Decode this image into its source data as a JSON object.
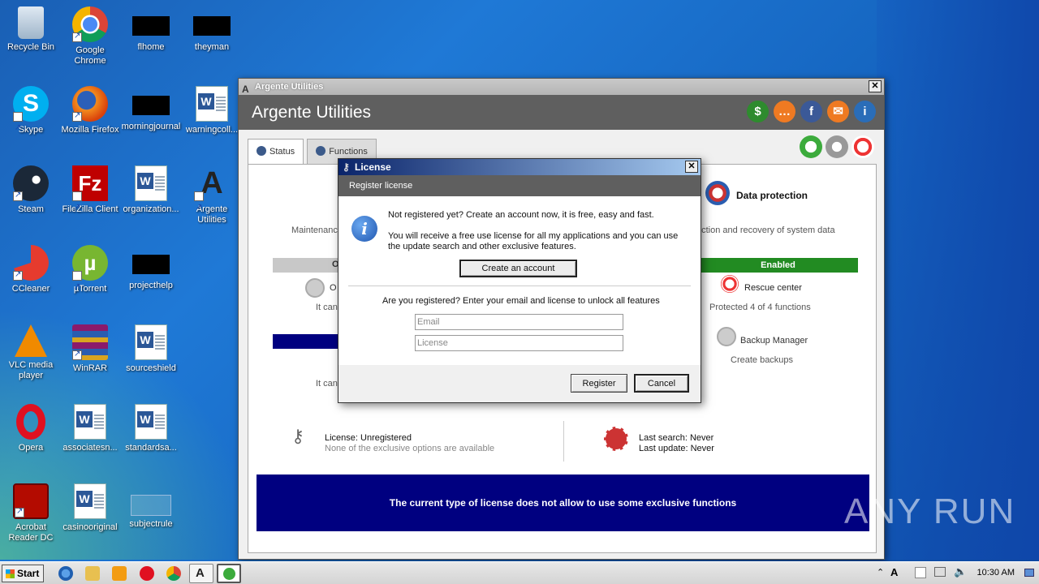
{
  "desktop": {
    "icons": [
      {
        "label": "Recycle Bin"
      },
      {
        "label": "Google Chrome"
      },
      {
        "label": "flhome"
      },
      {
        "label": "theyman"
      },
      {
        "label": "Skype"
      },
      {
        "label": "Mozilla Firefox"
      },
      {
        "label": "morningjournal"
      },
      {
        "label": "warningcoll..."
      },
      {
        "label": "Steam"
      },
      {
        "label": "FileZilla Client"
      },
      {
        "label": "organization..."
      },
      {
        "label": "Argente Utilities"
      },
      {
        "label": "CCleaner"
      },
      {
        "label": "µTorrent"
      },
      {
        "label": "projecthelp"
      },
      {
        "label": "VLC media player"
      },
      {
        "label": "WinRAR"
      },
      {
        "label": "sourceshield"
      },
      {
        "label": "Opera"
      },
      {
        "label": "associatesn..."
      },
      {
        "label": "standardsa..."
      },
      {
        "label": "Acrobat Reader DC"
      },
      {
        "label": "casinooriginal"
      },
      {
        "label": "subjectrule"
      }
    ]
  },
  "window": {
    "title": "Argente Utilities",
    "header": "Argente Utilities",
    "tabs": [
      {
        "label": "Status"
      },
      {
        "label": "Functions"
      }
    ],
    "status": {
      "maintenance": "Maintenanc",
      "data_protection_title": "Data protection",
      "data_protection_desc": "ection and recovery of system data",
      "o_label": "O",
      "it_can_1": "It can",
      "it_can_2": "It can",
      "enabled": "Enabled",
      "rescue_center": "Rescue center",
      "protected": "Protected 4 of 4 functions",
      "backup_manager": "Backup Manager",
      "create_backups": "Create backups",
      "license_label": "License: Unregistered",
      "license_desc": "None of the exclusive options are available",
      "last_search": "Last search: Never",
      "last_update": "Last update: Never",
      "banner": "The current type of license does not allow to use some exclusive functions"
    }
  },
  "dialog": {
    "title": "License",
    "subtitle": "Register license",
    "line1": "Not registered yet? Create an account now, it is free, easy and fast.",
    "line2": "You will receive a free use license for all my applications and you can use",
    "line3": "the update search and other exclusive features.",
    "create_account": "Create an account",
    "question": "Are you registered? Enter your email and license to unlock all features",
    "email_placeholder": "Email",
    "license_placeholder": "License",
    "register": "Register",
    "cancel": "Cancel"
  },
  "taskbar": {
    "start": "Start",
    "clock": "10:30 AM"
  },
  "watermark": "ANY RUN",
  "colors": {
    "enabled_green": "#228b22",
    "banner_navy": "#000080",
    "header_grey": "#5f5f5f"
  }
}
